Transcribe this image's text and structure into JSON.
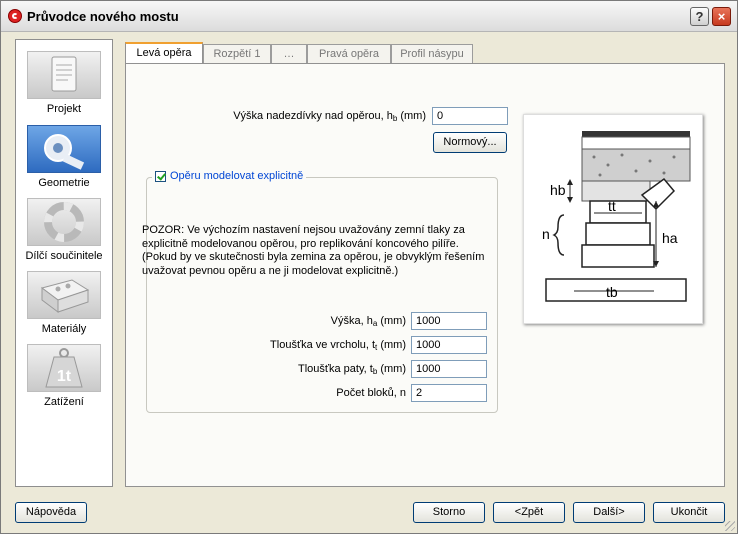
{
  "window": {
    "title": "Průvodce nového mostu",
    "help_label": "?",
    "close_label": "×"
  },
  "sidebar": {
    "items": [
      {
        "label": "Projekt",
        "icon": "document-icon"
      },
      {
        "label": "Geometrie",
        "icon": "tape-measure-icon"
      },
      {
        "label": "Dílčí součinitele",
        "icon": "lifebuoy-icon"
      },
      {
        "label": "Materiály",
        "icon": "brick-icon"
      },
      {
        "label": "Zatížení",
        "icon": "weight-icon",
        "glyph": "1t"
      }
    ],
    "selected": "Geometrie"
  },
  "tabs": [
    {
      "label": "Levá opěra",
      "active": true
    },
    {
      "label": "Rozpětí 1",
      "active": false
    },
    {
      "label": "…",
      "active": false
    },
    {
      "label": "Pravá opěra",
      "active": false
    },
    {
      "label": "Profil násypu",
      "active": false
    }
  ],
  "form": {
    "fill_height": {
      "label": "Výška nadezdívky nad opěrou, h",
      "sub": "b",
      "unit": " (mm)",
      "value": "0"
    },
    "default_button": "Normový...",
    "explicit_checkbox": {
      "label": "Opěru modelovat explicitně",
      "checked": true
    },
    "warning": "POZOR: Ve výchozím nastavení nejsou uvažovány zemní tlaky za explicitně modelovanou opěrou, pro replikování koncového pilíře. (Pokud by ve skutečnosti byla zemina za opěrou, je obvyklým řešením uvažovat pevnou opěru a ne ji modelovat explicitně.)",
    "fields": [
      {
        "label": "Výška, h",
        "sub": "a",
        "unit": " (mm)",
        "value": "1000"
      },
      {
        "label": "Tloušťka ve vrcholu, t",
        "sub": "t",
        "unit": " (mm)",
        "value": "1000"
      },
      {
        "label": "Tloušťka paty, t",
        "sub": "b",
        "unit": " (mm)",
        "value": "1000"
      },
      {
        "label": "Počet bloků, n",
        "sub": "",
        "unit": "",
        "value": "2"
      }
    ]
  },
  "illustration": {
    "labels": {
      "hb": "hb",
      "tt": "tt",
      "ha": "ha",
      "n": "n",
      "tb": "tb"
    }
  },
  "footer": {
    "help": "Nápověda",
    "cancel": "Storno",
    "back": "<Zpět",
    "next": "Další>",
    "finish": "Ukončit"
  }
}
